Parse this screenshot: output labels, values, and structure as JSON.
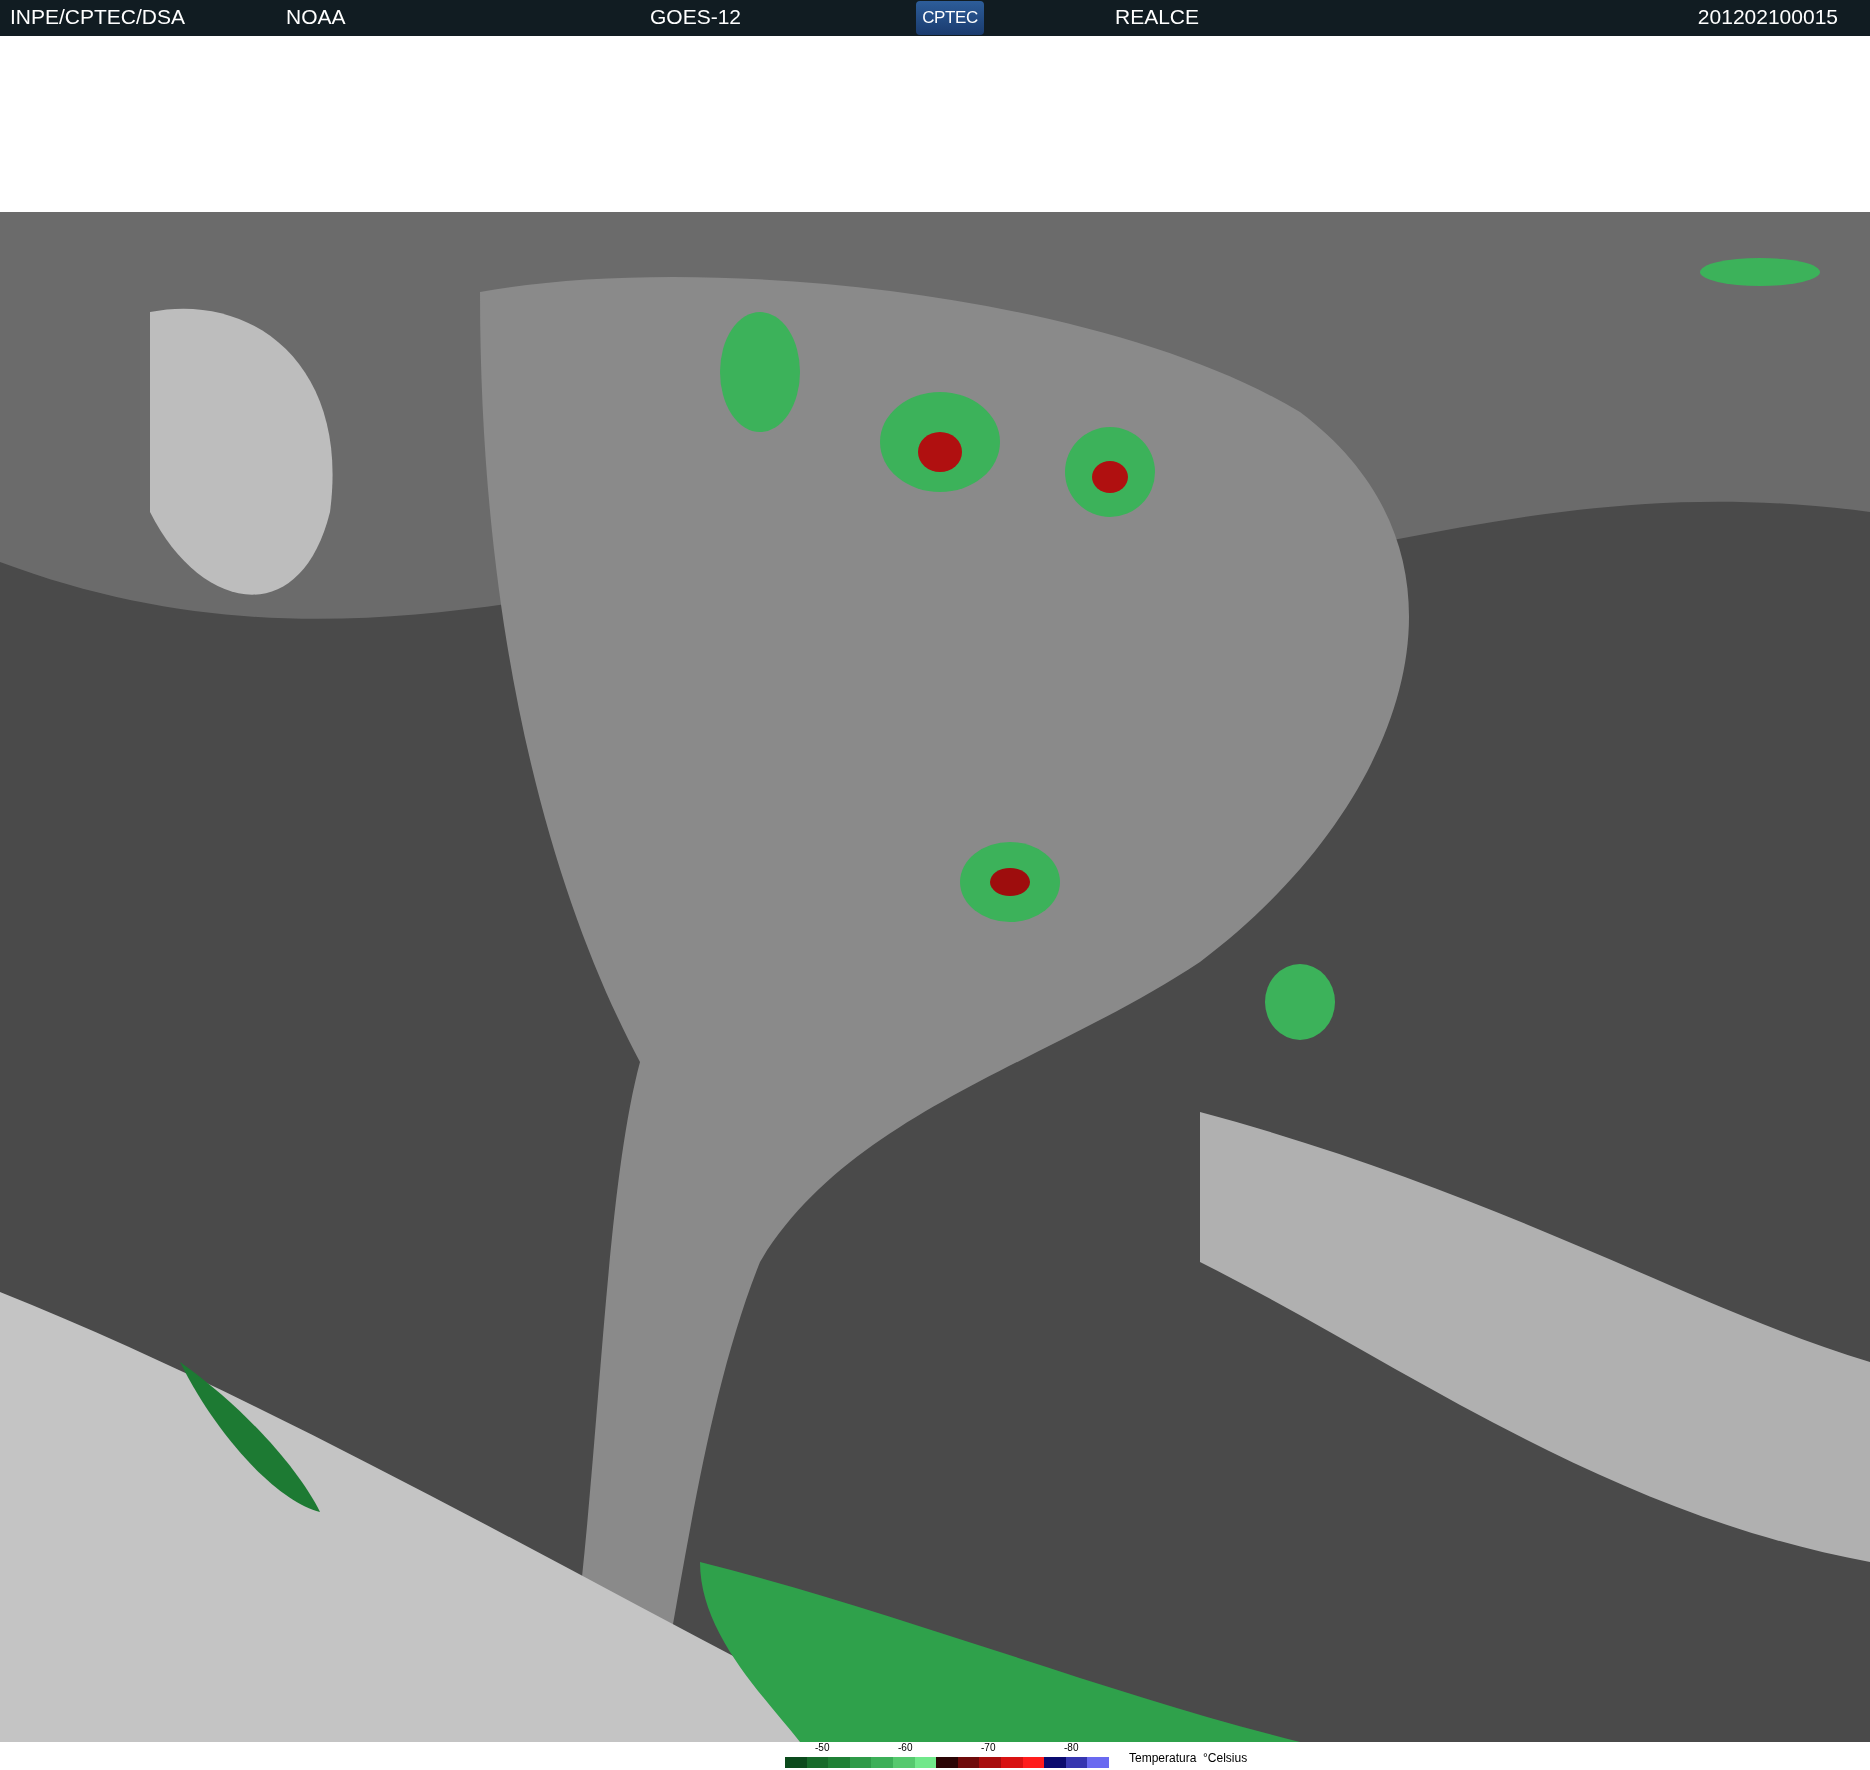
{
  "header": {
    "items": [
      {
        "kind": "text",
        "text": "INPE/CPTEC/DSA"
      },
      {
        "kind": "text",
        "text": "NOAA"
      },
      {
        "kind": "text",
        "text": "GOES-12"
      },
      {
        "kind": "logo",
        "text": "CPTEC"
      },
      {
        "kind": "text",
        "text": "REALCE"
      },
      {
        "kind": "text",
        "text": "201202100015"
      }
    ]
  },
  "legend": {
    "ticks": [
      "-50",
      "-60",
      "-70",
      "-80"
    ],
    "swatches": [
      {
        "color": "#0b4a1c"
      },
      {
        "color": "#166b2a"
      },
      {
        "color": "#1f8035"
      },
      {
        "color": "#2e9a48"
      },
      {
        "color": "#3caf58"
      },
      {
        "color": "#55c96e"
      },
      {
        "color": "#70e88a"
      },
      {
        "color": "#2a0505"
      },
      {
        "color": "#6e0a0a"
      },
      {
        "color": "#a80d0d"
      },
      {
        "color": "#d81212"
      },
      {
        "color": "#ff1c1c"
      },
      {
        "color": "#0a0a6e"
      },
      {
        "color": "#3636b0"
      },
      {
        "color": "#6a6af0"
      }
    ],
    "title": "Temperatura  °Celsius"
  }
}
